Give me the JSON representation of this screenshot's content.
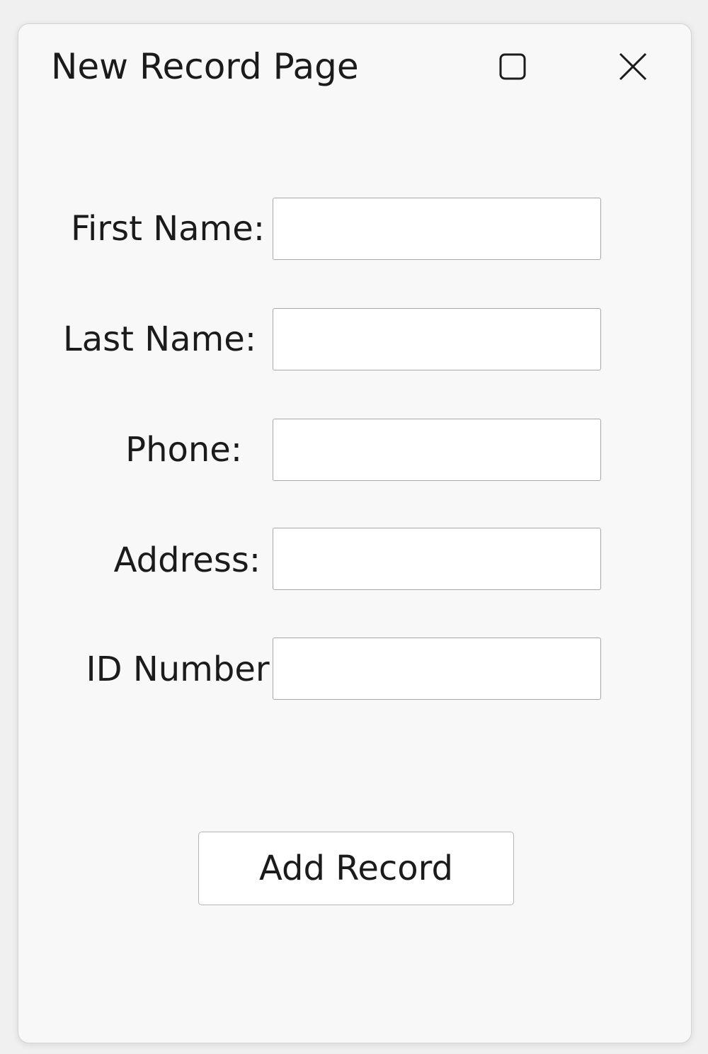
{
  "window": {
    "title": "New Record Page",
    "controls": {
      "maximize_icon": "maximize-icon",
      "close_icon": "close-icon"
    }
  },
  "form": {
    "fields": [
      {
        "label": "First Name:",
        "value": "",
        "placeholder": ""
      },
      {
        "label": "Last Name:",
        "value": "",
        "placeholder": ""
      },
      {
        "label": "Phone:",
        "value": "",
        "placeholder": ""
      },
      {
        "label": "Address:",
        "value": "",
        "placeholder": ""
      },
      {
        "label": "ID Number:",
        "value": "",
        "placeholder": ""
      }
    ],
    "submit_label": "Add Record"
  },
  "colors": {
    "window_bg": "#f8f8f8",
    "field_border": "#a8a8a8",
    "text": "#1b1b1b"
  }
}
